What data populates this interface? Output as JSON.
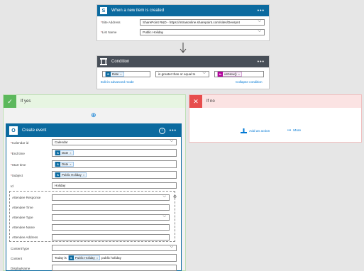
{
  "trigger": {
    "title": "When a new item is created",
    "menu": "•••",
    "site_label": "Site Address",
    "site_value": "SharePoint R&D - https://mtrasonline.sharepoint.com/sites/Devspnt",
    "list_label": "List Name",
    "list_value": "Public Holiday",
    "required": "*"
  },
  "condition": {
    "title": "Condition",
    "menu": "•••",
    "left_token": "Date",
    "operator": "is greater than or equal to",
    "right_token": "utcNow()",
    "edit_advanced": "Edit in advanced mode",
    "collapse": "Collapse condition"
  },
  "if_yes": {
    "title": "If yes",
    "add_glyph": "⊕",
    "action": {
      "title": "Create event",
      "info": "i",
      "menu": "•••",
      "fields": [
        {
          "label": "Calendar id",
          "required": true,
          "value": "Calendar"
        },
        {
          "label": "End time",
          "required": true,
          "token": "Date"
        },
        {
          "label": "Start time",
          "required": true,
          "token": "Date"
        },
        {
          "label": "Subject",
          "required": true,
          "token": "Public Holiday"
        },
        {
          "label": "Id",
          "required": false,
          "value": "Holiday"
        }
      ],
      "attendees": [
        {
          "label": "Attendee Response"
        },
        {
          "label": "Attendee Time"
        },
        {
          "label": "Attendee Type"
        },
        {
          "label": "Attendee Name"
        },
        {
          "label": "Attendee Address"
        }
      ],
      "content_type_label": "ContentType",
      "content_label": "Content",
      "content_prefix": "Today is",
      "content_token": "Public Holiday",
      "content_suffix": "public holiday",
      "display_name_label": "DisplayName"
    }
  },
  "if_no": {
    "title": "If no",
    "add_action": "Add an action",
    "more": "More",
    "more_glyph": "•••"
  },
  "colors": {
    "trigger_head": "#0b6a9f",
    "condition_head": "#484f58",
    "yes_bg": "#e7f5e2",
    "no_bg": "#fbe3e3",
    "outlook_head": "#0b6a9f"
  }
}
